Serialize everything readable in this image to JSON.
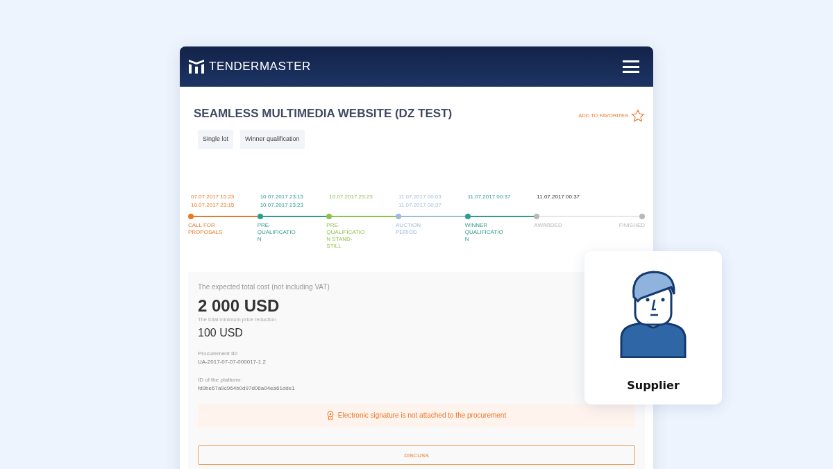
{
  "header": {
    "logo": "**TENDER**MASTER"
  },
  "title": "SEAMLESS MULTIMEDIA WEBSITE (DZ TEST)",
  "favorites": {
    "label": "ADD TO FAVORITES",
    "selected": false
  },
  "tags": [
    "Single lot",
    "Winner qualification"
  ],
  "timeline": [
    {
      "label": "CALL FOR PROPOSALS",
      "color": "#e8782a",
      "kind": "done",
      "dates": [
        "07.07.2017 15:23",
        "10.07.2017 23:15"
      ]
    },
    {
      "label": "PRE-QUALIFICATION",
      "color": "#2a9d8f",
      "kind": "done",
      "dates": [
        "10.07.2017 23:15",
        "10.07.2017 23:23"
      ]
    },
    {
      "label": "PRE-QUALIFICATION STAND-STILL",
      "color": "#8bc34a",
      "kind": "done",
      "dates": [
        "10.07.2017 23:23"
      ]
    },
    {
      "label": "AUCTION PERIOD",
      "color": "#9bbcdc",
      "kind": "done",
      "dates": [
        "11.07.2017 00:03",
        "11.07.2017 00:37"
      ]
    },
    {
      "label": "WINNER QUALIFICATION",
      "color": "#2a9d8f",
      "kind": "done",
      "dates": [
        "11.07.2017 00:37"
      ]
    },
    {
      "label": "AWARDED",
      "color": "#b8b8b8",
      "kind": "pending",
      "dates": [
        "11.07.2017 00:37"
      ]
    },
    {
      "label": "FINISHED",
      "color": "#b8b8b8",
      "kind": "pending"
    }
  ],
  "info": {
    "cost_label": "The expected total cost (not including VAT)",
    "cost": "2 000 USD",
    "reduction_label": "The total minimum price reduction",
    "reduction": "100 USD",
    "procurement_id_label": "Procurement ID:",
    "procurement_id": "UA-2017-07-07-000017-1.2",
    "platform_id_label": "ID of the platform:",
    "platform_id": "fd9be67a9c964b0d97d06a04ea61dde1"
  },
  "warning": "Electronic signature is not attached to the procurement",
  "discuss_button": "DISCUSS",
  "role_card": {
    "label": "Supplier"
  }
}
